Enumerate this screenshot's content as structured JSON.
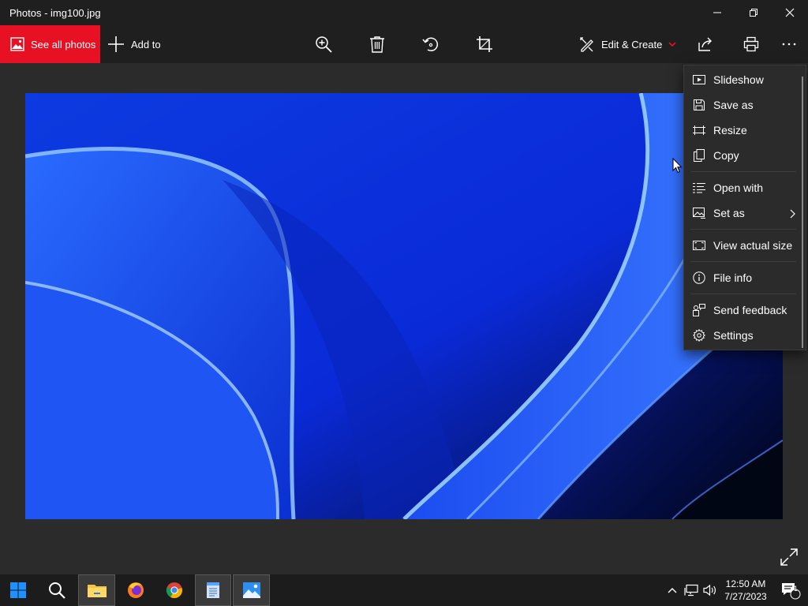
{
  "window": {
    "title": "Photos - img100.jpg",
    "controls": [
      "minimize-icon",
      "restore-icon",
      "close-icon"
    ]
  },
  "toolbar": {
    "see_all_label": "See all photos",
    "add_to_label": "Add to",
    "tools": [
      "zoom-in-icon",
      "delete-icon",
      "rotate-icon",
      "crop-icon"
    ],
    "edit_create_label": "Edit & Create",
    "right_tools": [
      "share-icon",
      "print-icon",
      "more-icon"
    ],
    "accent": "#e81123"
  },
  "menu": {
    "items": [
      {
        "label": "Slideshow",
        "icon": "slideshow-icon"
      },
      {
        "label": "Save as",
        "icon": "save-icon"
      },
      {
        "label": "Resize",
        "icon": "resize-icon"
      },
      {
        "label": "Copy",
        "icon": "copy-icon"
      },
      {
        "label": "Open with",
        "icon": "open-with-icon"
      },
      {
        "label": "Set as",
        "icon": "set-as-icon",
        "submenu": true
      },
      {
        "label": "View actual size",
        "icon": "actual-size-icon"
      },
      {
        "label": "File info",
        "icon": "info-icon"
      },
      {
        "label": "Send feedback",
        "icon": "feedback-icon"
      },
      {
        "label": "Settings",
        "icon": "gear-icon"
      }
    ]
  },
  "taskbar": {
    "apps": [
      "start-icon",
      "search-icon",
      "file-explorer-icon",
      "firefox-icon",
      "chrome-icon",
      "notepad-icon",
      "photos-icon"
    ],
    "time": "12:50 AM",
    "date": "7/27/2023",
    "notification_count": "1"
  }
}
